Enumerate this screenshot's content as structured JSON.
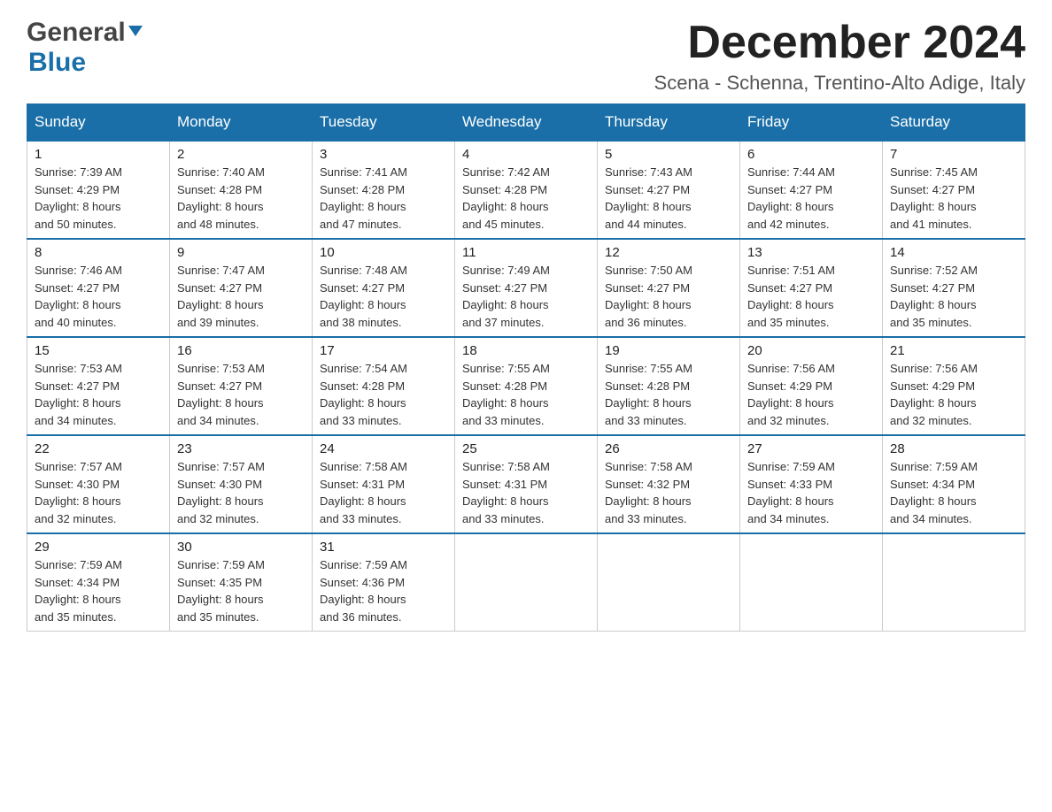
{
  "header": {
    "logo_general": "General",
    "logo_blue": "Blue",
    "month_title": "December 2024",
    "location": "Scena - Schenna, Trentino-Alto Adige, Italy"
  },
  "days_of_week": [
    "Sunday",
    "Monday",
    "Tuesday",
    "Wednesday",
    "Thursday",
    "Friday",
    "Saturday"
  ],
  "weeks": [
    [
      {
        "day": "1",
        "sunrise": "7:39 AM",
        "sunset": "4:29 PM",
        "daylight": "8 hours and 50 minutes."
      },
      {
        "day": "2",
        "sunrise": "7:40 AM",
        "sunset": "4:28 PM",
        "daylight": "8 hours and 48 minutes."
      },
      {
        "day": "3",
        "sunrise": "7:41 AM",
        "sunset": "4:28 PM",
        "daylight": "8 hours and 47 minutes."
      },
      {
        "day": "4",
        "sunrise": "7:42 AM",
        "sunset": "4:28 PM",
        "daylight": "8 hours and 45 minutes."
      },
      {
        "day": "5",
        "sunrise": "7:43 AM",
        "sunset": "4:27 PM",
        "daylight": "8 hours and 44 minutes."
      },
      {
        "day": "6",
        "sunrise": "7:44 AM",
        "sunset": "4:27 PM",
        "daylight": "8 hours and 42 minutes."
      },
      {
        "day": "7",
        "sunrise": "7:45 AM",
        "sunset": "4:27 PM",
        "daylight": "8 hours and 41 minutes."
      }
    ],
    [
      {
        "day": "8",
        "sunrise": "7:46 AM",
        "sunset": "4:27 PM",
        "daylight": "8 hours and 40 minutes."
      },
      {
        "day": "9",
        "sunrise": "7:47 AM",
        "sunset": "4:27 PM",
        "daylight": "8 hours and 39 minutes."
      },
      {
        "day": "10",
        "sunrise": "7:48 AM",
        "sunset": "4:27 PM",
        "daylight": "8 hours and 38 minutes."
      },
      {
        "day": "11",
        "sunrise": "7:49 AM",
        "sunset": "4:27 PM",
        "daylight": "8 hours and 37 minutes."
      },
      {
        "day": "12",
        "sunrise": "7:50 AM",
        "sunset": "4:27 PM",
        "daylight": "8 hours and 36 minutes."
      },
      {
        "day": "13",
        "sunrise": "7:51 AM",
        "sunset": "4:27 PM",
        "daylight": "8 hours and 35 minutes."
      },
      {
        "day": "14",
        "sunrise": "7:52 AM",
        "sunset": "4:27 PM",
        "daylight": "8 hours and 35 minutes."
      }
    ],
    [
      {
        "day": "15",
        "sunrise": "7:53 AM",
        "sunset": "4:27 PM",
        "daylight": "8 hours and 34 minutes."
      },
      {
        "day": "16",
        "sunrise": "7:53 AM",
        "sunset": "4:27 PM",
        "daylight": "8 hours and 34 minutes."
      },
      {
        "day": "17",
        "sunrise": "7:54 AM",
        "sunset": "4:28 PM",
        "daylight": "8 hours and 33 minutes."
      },
      {
        "day": "18",
        "sunrise": "7:55 AM",
        "sunset": "4:28 PM",
        "daylight": "8 hours and 33 minutes."
      },
      {
        "day": "19",
        "sunrise": "7:55 AM",
        "sunset": "4:28 PM",
        "daylight": "8 hours and 33 minutes."
      },
      {
        "day": "20",
        "sunrise": "7:56 AM",
        "sunset": "4:29 PM",
        "daylight": "8 hours and 32 minutes."
      },
      {
        "day": "21",
        "sunrise": "7:56 AM",
        "sunset": "4:29 PM",
        "daylight": "8 hours and 32 minutes."
      }
    ],
    [
      {
        "day": "22",
        "sunrise": "7:57 AM",
        "sunset": "4:30 PM",
        "daylight": "8 hours and 32 minutes."
      },
      {
        "day": "23",
        "sunrise": "7:57 AM",
        "sunset": "4:30 PM",
        "daylight": "8 hours and 32 minutes."
      },
      {
        "day": "24",
        "sunrise": "7:58 AM",
        "sunset": "4:31 PM",
        "daylight": "8 hours and 33 minutes."
      },
      {
        "day": "25",
        "sunrise": "7:58 AM",
        "sunset": "4:31 PM",
        "daylight": "8 hours and 33 minutes."
      },
      {
        "day": "26",
        "sunrise": "7:58 AM",
        "sunset": "4:32 PM",
        "daylight": "8 hours and 33 minutes."
      },
      {
        "day": "27",
        "sunrise": "7:59 AM",
        "sunset": "4:33 PM",
        "daylight": "8 hours and 34 minutes."
      },
      {
        "day": "28",
        "sunrise": "7:59 AM",
        "sunset": "4:34 PM",
        "daylight": "8 hours and 34 minutes."
      }
    ],
    [
      {
        "day": "29",
        "sunrise": "7:59 AM",
        "sunset": "4:34 PM",
        "daylight": "8 hours and 35 minutes."
      },
      {
        "day": "30",
        "sunrise": "7:59 AM",
        "sunset": "4:35 PM",
        "daylight": "8 hours and 35 minutes."
      },
      {
        "day": "31",
        "sunrise": "7:59 AM",
        "sunset": "4:36 PM",
        "daylight": "8 hours and 36 minutes."
      },
      null,
      null,
      null,
      null
    ]
  ],
  "labels": {
    "sunrise": "Sunrise: ",
    "sunset": "Sunset: ",
    "daylight": "Daylight: "
  }
}
